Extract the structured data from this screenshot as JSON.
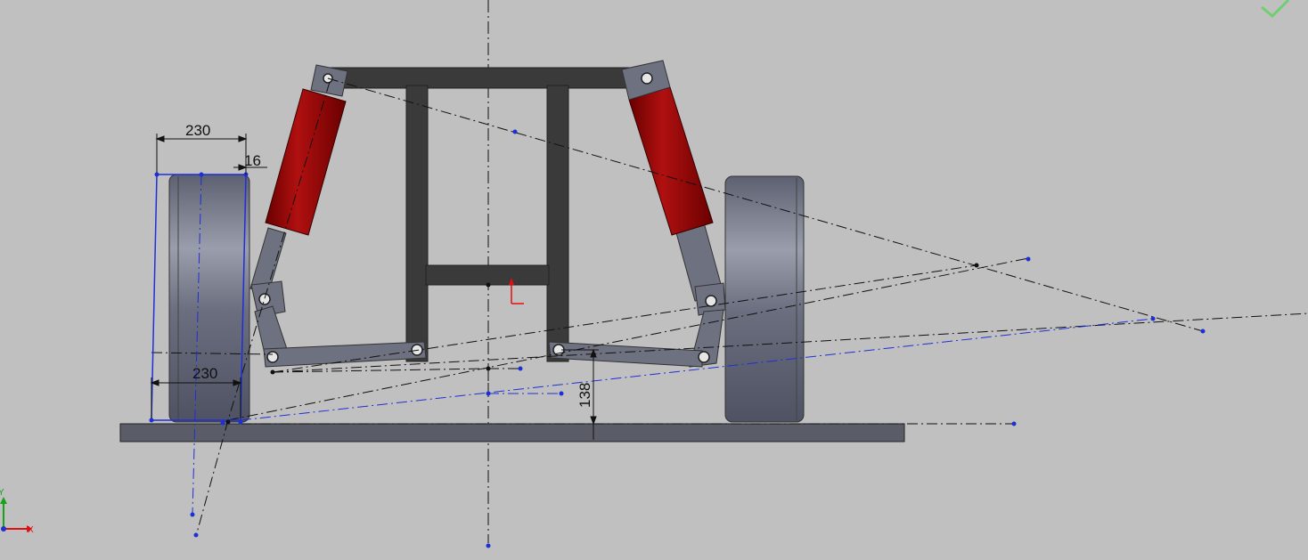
{
  "dimensions": {
    "wheel_width_top": "230",
    "wheel_offset": "16",
    "wheel_width_bottom": "230",
    "ride_height": "138"
  },
  "triad": {
    "x_label": "X",
    "y_label": "Y"
  },
  "colors": {
    "background": "#c0c0c0",
    "chassis": "#3a3a3a",
    "damper_body": "#8b0000",
    "linkage": "#6e7180",
    "tire": "#6a6e7e",
    "ground_plate": "#5a5d68",
    "sketch_blue": "#1f2fd6",
    "sketch_black": "#111111",
    "origin_red": "#e01010",
    "confirm_green": "#6fcf6f"
  },
  "icons": [
    "confirm-check-icon",
    "origin-marker-icon",
    "coordinate-triad-icon"
  ]
}
